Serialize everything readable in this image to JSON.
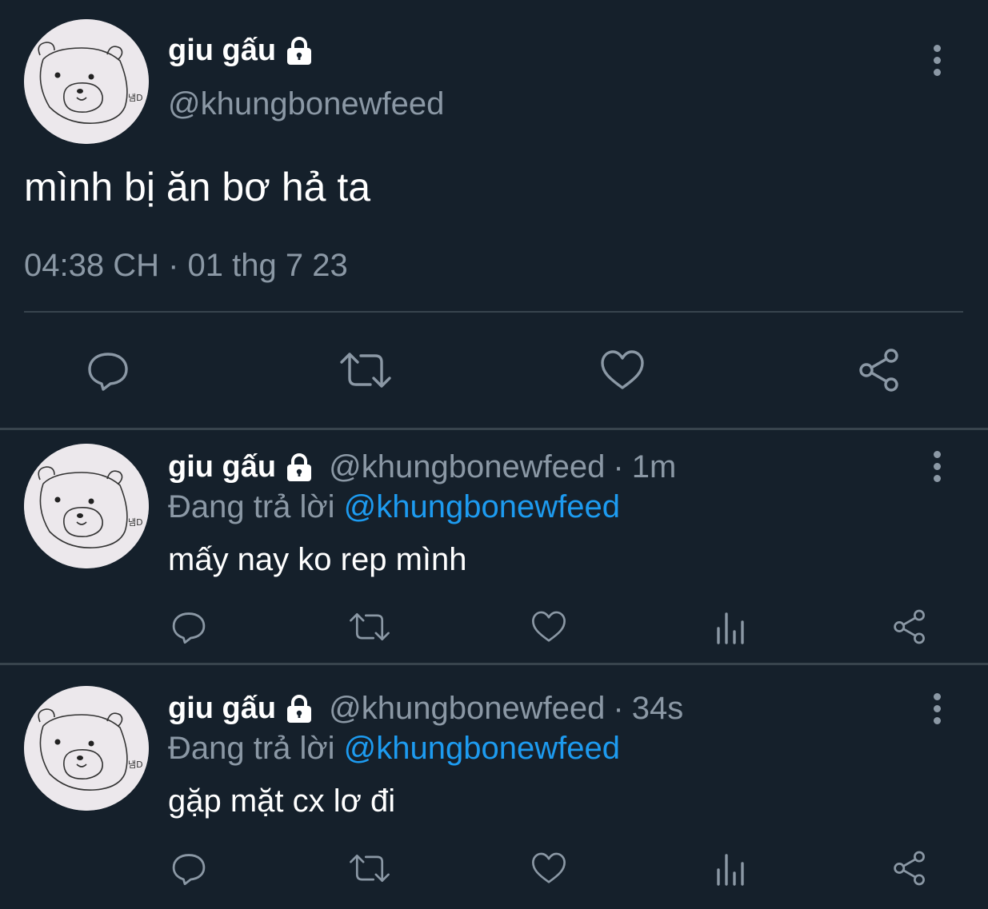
{
  "main_tweet": {
    "name": "giu gấu",
    "handle": "@khungbonewfeed",
    "text": "mình bị ăn bơ hả ta",
    "timestamp": "04:38 CH · 01 thg 7 23",
    "avatar_icon": "bear-drawing-avatar",
    "avatar_tag": "냄D"
  },
  "replies": [
    {
      "name": "giu gấu",
      "handle": "@khungbonewfeed",
      "time": "1m",
      "replying_label": "Đang trả lời",
      "replying_to": "@khungbonewfeed",
      "text": "mấy nay ko rep mình"
    },
    {
      "name": "giu gấu",
      "handle": "@khungbonewfeed",
      "time": "34s",
      "replying_label": "Đang trả lời",
      "replying_to": "@khungbonewfeed",
      "text": "gặp mặt cx lơ đi"
    }
  ],
  "colors": {
    "background": "#15202b",
    "secondary_text": "#8b98a5",
    "link": "#1d9bf0",
    "divider": "#38444d"
  },
  "icons": [
    "lock-icon",
    "more-options-icon",
    "reply-icon",
    "retweet-icon",
    "like-icon",
    "views-icon",
    "share-icon"
  ]
}
